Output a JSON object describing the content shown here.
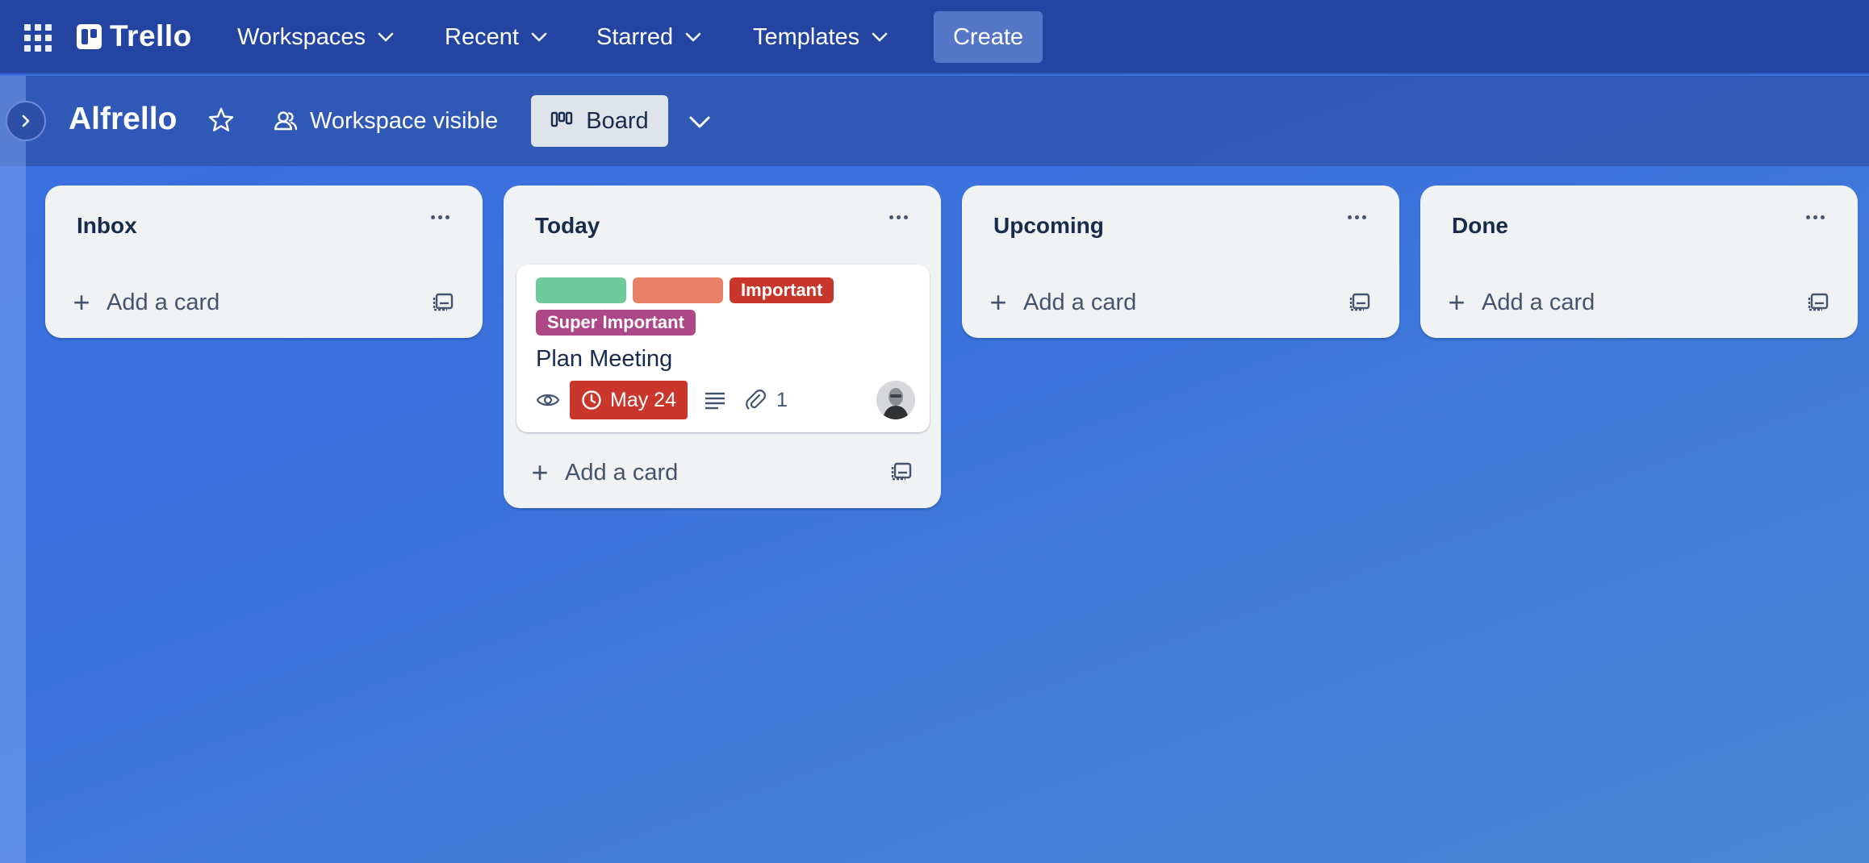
{
  "colors": {
    "topbar": "#2344a0",
    "accent_create": "#5576c6",
    "list_bg": "#f1f2f4",
    "label_green": "#6fcb9b",
    "label_orange": "#e8806a",
    "label_important": "#c9372c",
    "label_super_important": "#ae4787",
    "due_overdue": "#c9372c"
  },
  "topnav": {
    "logo": "Trello",
    "items": [
      {
        "label": "Workspaces"
      },
      {
        "label": "Recent"
      },
      {
        "label": "Starred"
      },
      {
        "label": "Templates"
      }
    ],
    "create_label": "Create"
  },
  "board": {
    "title": "Alfrello",
    "visibility": "Workspace visible",
    "view": "Board"
  },
  "lists": [
    {
      "title": "Inbox",
      "add_card_label": "Add a card"
    },
    {
      "title": "Today",
      "add_card_label": "Add a card"
    },
    {
      "title": "Upcoming",
      "add_card_label": "Add a card"
    },
    {
      "title": "Done",
      "add_card_label": "Add a card"
    }
  ],
  "card": {
    "labels": [
      {
        "text": "",
        "color": "#6fcb9b"
      },
      {
        "text": "",
        "color": "#e8806a"
      },
      {
        "text": "Important",
        "color": "#c9372c"
      },
      {
        "text": "Super Important",
        "color": "#ae4787"
      }
    ],
    "title": "Plan Meeting",
    "due": "May 24",
    "attachments": "1"
  }
}
